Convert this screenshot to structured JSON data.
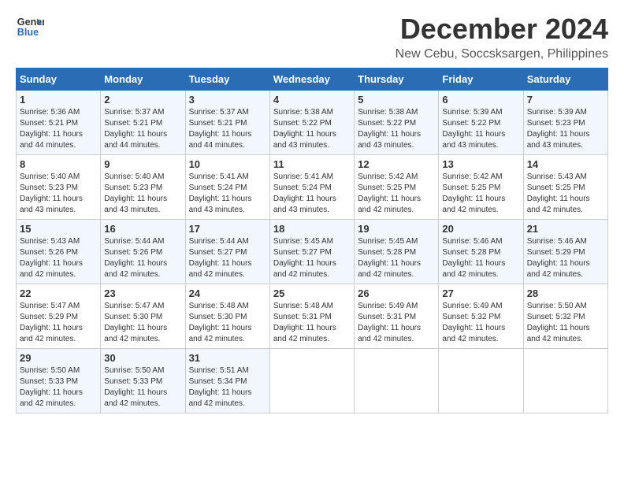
{
  "logo": {
    "line1": "General",
    "line2": "Blue"
  },
  "header": {
    "title": "December 2024",
    "location": "New Cebu, Soccsksargen, Philippines"
  },
  "days_of_week": [
    "Sunday",
    "Monday",
    "Tuesday",
    "Wednesday",
    "Thursday",
    "Friday",
    "Saturday"
  ],
  "weeks": [
    [
      {
        "day": "1",
        "sunrise": "5:36 AM",
        "sunset": "5:21 PM",
        "daylight": "11 hours and 44 minutes."
      },
      {
        "day": "2",
        "sunrise": "5:37 AM",
        "sunset": "5:21 PM",
        "daylight": "11 hours and 44 minutes."
      },
      {
        "day": "3",
        "sunrise": "5:37 AM",
        "sunset": "5:21 PM",
        "daylight": "11 hours and 44 minutes."
      },
      {
        "day": "4",
        "sunrise": "5:38 AM",
        "sunset": "5:22 PM",
        "daylight": "11 hours and 43 minutes."
      },
      {
        "day": "5",
        "sunrise": "5:38 AM",
        "sunset": "5:22 PM",
        "daylight": "11 hours and 43 minutes."
      },
      {
        "day": "6",
        "sunrise": "5:39 AM",
        "sunset": "5:22 PM",
        "daylight": "11 hours and 43 minutes."
      },
      {
        "day": "7",
        "sunrise": "5:39 AM",
        "sunset": "5:23 PM",
        "daylight": "11 hours and 43 minutes."
      }
    ],
    [
      {
        "day": "8",
        "sunrise": "5:40 AM",
        "sunset": "5:23 PM",
        "daylight": "11 hours and 43 minutes."
      },
      {
        "day": "9",
        "sunrise": "5:40 AM",
        "sunset": "5:23 PM",
        "daylight": "11 hours and 43 minutes."
      },
      {
        "day": "10",
        "sunrise": "5:41 AM",
        "sunset": "5:24 PM",
        "daylight": "11 hours and 43 minutes."
      },
      {
        "day": "11",
        "sunrise": "5:41 AM",
        "sunset": "5:24 PM",
        "daylight": "11 hours and 43 minutes."
      },
      {
        "day": "12",
        "sunrise": "5:42 AM",
        "sunset": "5:25 PM",
        "daylight": "11 hours and 42 minutes."
      },
      {
        "day": "13",
        "sunrise": "5:42 AM",
        "sunset": "5:25 PM",
        "daylight": "11 hours and 42 minutes."
      },
      {
        "day": "14",
        "sunrise": "5:43 AM",
        "sunset": "5:25 PM",
        "daylight": "11 hours and 42 minutes."
      }
    ],
    [
      {
        "day": "15",
        "sunrise": "5:43 AM",
        "sunset": "5:26 PM",
        "daylight": "11 hours and 42 minutes."
      },
      {
        "day": "16",
        "sunrise": "5:44 AM",
        "sunset": "5:26 PM",
        "daylight": "11 hours and 42 minutes."
      },
      {
        "day": "17",
        "sunrise": "5:44 AM",
        "sunset": "5:27 PM",
        "daylight": "11 hours and 42 minutes."
      },
      {
        "day": "18",
        "sunrise": "5:45 AM",
        "sunset": "5:27 PM",
        "daylight": "11 hours and 42 minutes."
      },
      {
        "day": "19",
        "sunrise": "5:45 AM",
        "sunset": "5:28 PM",
        "daylight": "11 hours and 42 minutes."
      },
      {
        "day": "20",
        "sunrise": "5:46 AM",
        "sunset": "5:28 PM",
        "daylight": "11 hours and 42 minutes."
      },
      {
        "day": "21",
        "sunrise": "5:46 AM",
        "sunset": "5:29 PM",
        "daylight": "11 hours and 42 minutes."
      }
    ],
    [
      {
        "day": "22",
        "sunrise": "5:47 AM",
        "sunset": "5:29 PM",
        "daylight": "11 hours and 42 minutes."
      },
      {
        "day": "23",
        "sunrise": "5:47 AM",
        "sunset": "5:30 PM",
        "daylight": "11 hours and 42 minutes."
      },
      {
        "day": "24",
        "sunrise": "5:48 AM",
        "sunset": "5:30 PM",
        "daylight": "11 hours and 42 minutes."
      },
      {
        "day": "25",
        "sunrise": "5:48 AM",
        "sunset": "5:31 PM",
        "daylight": "11 hours and 42 minutes."
      },
      {
        "day": "26",
        "sunrise": "5:49 AM",
        "sunset": "5:31 PM",
        "daylight": "11 hours and 42 minutes."
      },
      {
        "day": "27",
        "sunrise": "5:49 AM",
        "sunset": "5:32 PM",
        "daylight": "11 hours and 42 minutes."
      },
      {
        "day": "28",
        "sunrise": "5:50 AM",
        "sunset": "5:32 PM",
        "daylight": "11 hours and 42 minutes."
      }
    ],
    [
      {
        "day": "29",
        "sunrise": "5:50 AM",
        "sunset": "5:33 PM",
        "daylight": "11 hours and 42 minutes."
      },
      {
        "day": "30",
        "sunrise": "5:50 AM",
        "sunset": "5:33 PM",
        "daylight": "11 hours and 42 minutes."
      },
      {
        "day": "31",
        "sunrise": "5:51 AM",
        "sunset": "5:34 PM",
        "daylight": "11 hours and 42 minutes."
      },
      null,
      null,
      null,
      null
    ]
  ]
}
